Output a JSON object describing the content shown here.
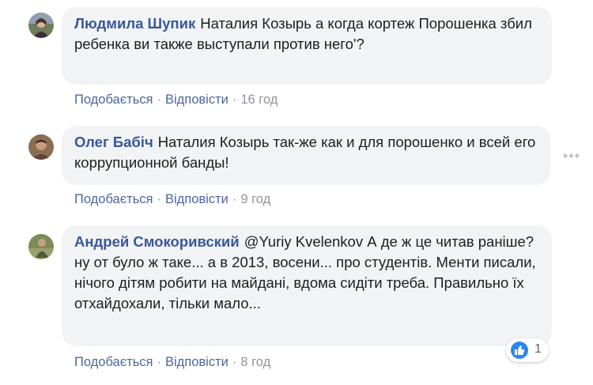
{
  "comments": [
    {
      "author": "Людмила Шупик",
      "text": "Наталия Козырь а когда кортеж Порошенка збил ребенка ви также выступали против него'?",
      "like": "Подобається",
      "reply": "Відповісти",
      "time": "16 год"
    },
    {
      "author": "Олег Бабіч",
      "text": "Наталия Козырь так-же как и для порошенко и всей его коррупционной банды!",
      "like": "Подобається",
      "reply": "Відповісти",
      "time": "9 год"
    },
    {
      "author": "Андрей Смокоривский",
      "text": "@Yuriy Kvelenkov А де ж це читав раніше? ну от було ж таке... а в 2013, восени... про студентів. Менти писали, нічого дітям робити на майдані, вдома сидіти треба. Правильно їх отхайдохали, тільки мало...",
      "like": "Подобається",
      "reply": "Відповісти",
      "time": "8 год",
      "reaction_count": "1"
    }
  ],
  "icons": {
    "more": "more-options-icon",
    "reaction": "like-icon"
  },
  "colors": {
    "author": "#385898",
    "bubble": "#f2f3f5",
    "link": "#4b67a1",
    "like_reaction": "#2e87f0"
  }
}
